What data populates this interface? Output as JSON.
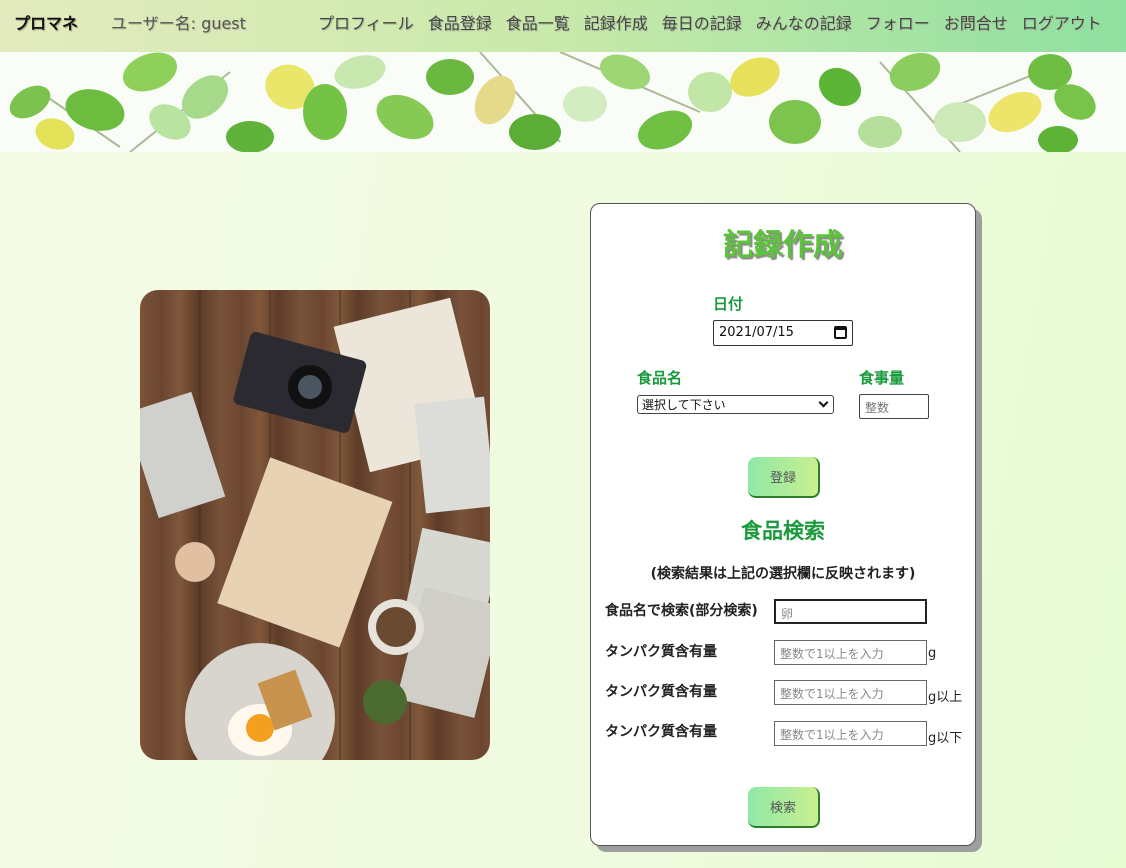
{
  "header": {
    "brand": "プロマネ",
    "username": "ユーザー名: guest",
    "nav": [
      "プロフィール",
      "食品登録",
      "食品一覧",
      "記録作成",
      "毎日の記録",
      "みんなの記録",
      "フォロー",
      "お問合せ",
      "ログアウト"
    ]
  },
  "form": {
    "title": "記録作成",
    "date_label": "日付",
    "date_value": "2021/07/15",
    "food_label": "食品名",
    "food_select_value": "選択して下さい",
    "amount_label": "食事量",
    "amount_placeholder": "整数",
    "register_button": "登録"
  },
  "search": {
    "title": "食品検索",
    "note": "(検索結果は上記の選択欄に反映されます)",
    "name_label": "食品名で検索(部分検索)",
    "name_value": "卵",
    "protein_label_1": "タンパク質含有量",
    "protein_label_2": "タンパク質含有量",
    "protein_label_3": "タンパク質含有量",
    "protein_placeholder_1": "整数で1以上を入力",
    "protein_placeholder_2": "整数で1以上を入力",
    "protein_placeholder_3": "整数で1以上を入力",
    "unit_1": "g",
    "unit_2": "g以上",
    "unit_3": "g以下",
    "search_button": "検索"
  },
  "colors": {
    "accent_green": "#1a9a3c",
    "title_green": "#5cc43a"
  }
}
